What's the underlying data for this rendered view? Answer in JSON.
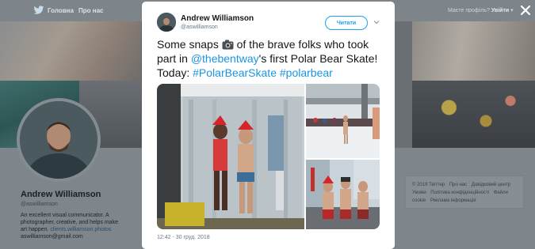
{
  "nav": {
    "home": "Головна",
    "about": "Про нас",
    "account_prompt": "Маєте профіль?",
    "login": "Увійти"
  },
  "profile": {
    "name": "Andrew Williamson",
    "handle": "@aswilliamson",
    "bio": "An excellent visual communicator. A photographer, creative, and helps make art happen.",
    "bio_link": "clients.williamson.photos",
    "email": "aswilliamson@gmail.com"
  },
  "footer": {
    "links": [
      "© 2019 Твіттер",
      "Про нас",
      "Довідковий центр",
      "Умови",
      "Політика конфіденційності",
      "Файли cookie",
      "Реклама інформація"
    ]
  },
  "tweet": {
    "author_name": "Andrew Williamson",
    "author_handle": "@aswilliamson",
    "follow_label": "Читати",
    "text_1": "Some snaps",
    "text_2": "of the brave folks who took part in",
    "mention": "@thebentway",
    "text_3": "'s first Polar Bear Skate! Today:",
    "hashtag_1": "#PolarBearSkate",
    "hashtag_2": "#polarbear",
    "timestamp": "12:42 - 30 груд. 2018"
  },
  "icons": {
    "bird": "twitter-bird-icon",
    "close": "close-icon",
    "caret": "chevron-down-icon",
    "camera": "camera-emoji-icon"
  },
  "colors": {
    "link": "#1b95e0",
    "follow": "#1da1f2",
    "overlay": "#7e858b"
  }
}
